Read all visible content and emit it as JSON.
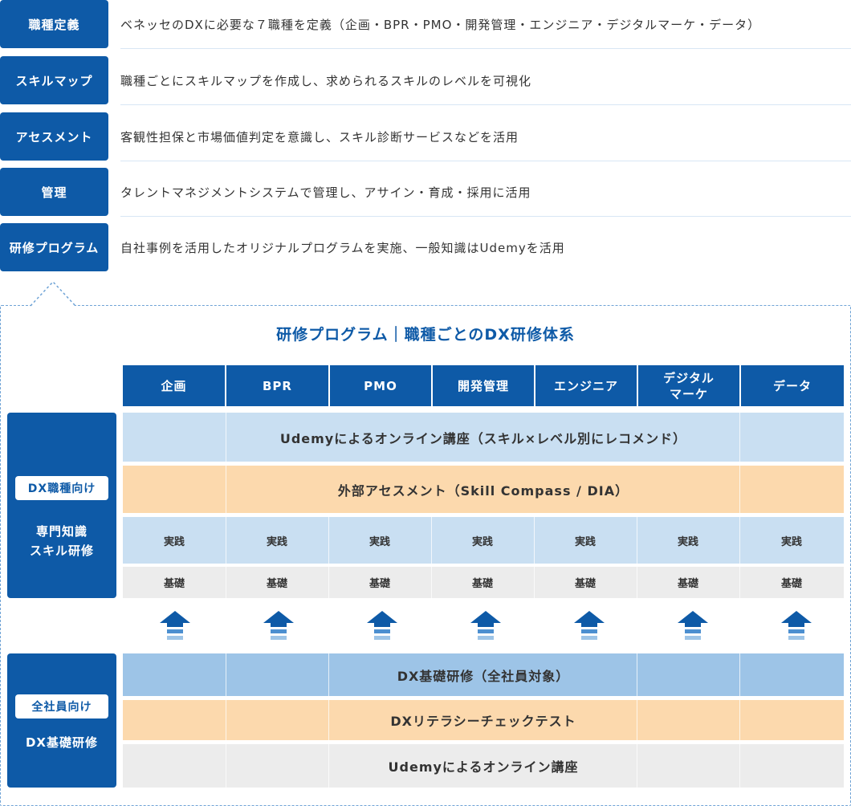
{
  "definitions": [
    {
      "label": "職種定義",
      "text": "ベネッセのDXに必要な７職種を定義（企画・BPR・PMO・開発管理・エンジニア・デジタルマーケ・データ）"
    },
    {
      "label": "スキルマップ",
      "text": "職種ごとにスキルマップを作成し、求められるスキルのレベルを可視化"
    },
    {
      "label": "アセスメント",
      "text": "客観性担保と市場価値判定を意識し、スキル診断サービスなどを活用"
    },
    {
      "label": "管理",
      "text": "タレントマネジメントシステムで管理し、アサイン・育成・採用に活用"
    },
    {
      "label": "研修プログラム",
      "text": "自社事例を活用したオリジナルプログラムを実施、一般知識はUdemyを活用"
    }
  ],
  "program": {
    "title": "研修プログラム｜職種ごとのDX研修体系",
    "columns": [
      "企画",
      "BPR",
      "PMO",
      "開発管理",
      "エンジニア",
      "デジタル\nマーケ",
      "データ"
    ],
    "groups": [
      {
        "tag": "DX職種向け",
        "text": "専門知識\nスキル研修"
      },
      {
        "tag": "全社員向け",
        "text": "DX基礎研修"
      }
    ],
    "bands": {
      "udemy_recommend": "Udemyによるオンライン講座（スキル×レベル別にレコメンド）",
      "external_assessment": "外部アセスメント（Skill Compass / DIA）",
      "practice": "実践",
      "basic": "基礎",
      "dx_basic_training": "DX基礎研修（全社員対象）",
      "dx_literacy_test": "DXリテラシーチェックテスト",
      "udemy_online": "Udemyによるオンライン講座"
    }
  },
  "colors": {
    "primary": "#0e5aa7",
    "light_blue": "#c9dff2",
    "mid_blue": "#9dc4e7",
    "peach": "#fcd9ad",
    "light_gray": "#ececec",
    "arrow": "#0e5aa7"
  },
  "icons": {
    "arrow": "up-arrow-icon"
  }
}
